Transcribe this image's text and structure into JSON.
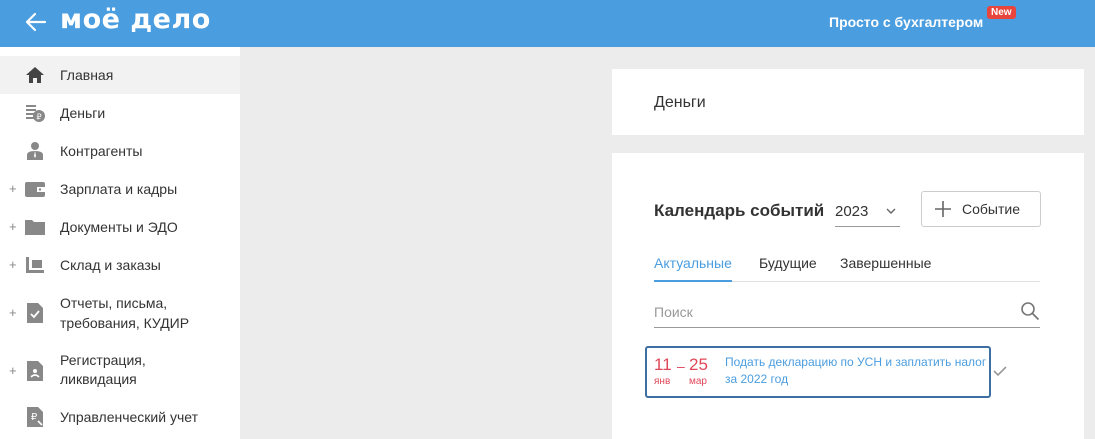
{
  "header": {
    "logo": "моё дело",
    "accountant_link": "Просто с бухгалтером",
    "new_badge": "New"
  },
  "sidebar": {
    "items": [
      {
        "label": "Главная",
        "icon": "home-icon",
        "active": true
      },
      {
        "label": "Деньги",
        "icon": "money-icon"
      },
      {
        "label": "Контрагенты",
        "icon": "contractor-icon"
      },
      {
        "label": "Зарплата и кадры",
        "icon": "wallet-icon",
        "expandable": true
      },
      {
        "label": "Документы и ЭДО",
        "icon": "folder-icon",
        "expandable": true
      },
      {
        "label": "Склад и заказы",
        "icon": "warehouse-icon",
        "expandable": true
      },
      {
        "label_line1": "Отчеты, письма,",
        "label_line2": "требования, КУДИР",
        "icon": "report-icon",
        "expandable": true
      },
      {
        "label_line1": "Регистрация,",
        "label_line2": "ликвидация",
        "icon": "registration-icon",
        "expandable": true
      },
      {
        "label": "Управленческий учет",
        "icon": "management-icon"
      }
    ]
  },
  "money_card": {
    "title": "Деньги"
  },
  "calendar": {
    "title": "Календарь событий",
    "year": "2023",
    "add_event_label": "Событие",
    "tabs": [
      "Актуальные",
      "Будущие",
      "Завершенные"
    ],
    "active_tab": "Актуальные",
    "search_placeholder": "Поиск",
    "events": [
      {
        "day_start": "11",
        "month_start": "янв",
        "dash": "–",
        "day_end": "25",
        "month_end": "мар",
        "text": "Подать декларацию по УСН и заплатить налог за 2022 год"
      }
    ]
  },
  "colors": {
    "header_bg": "#4a9ddf",
    "accent": "#4a9ddf",
    "date_red": "#e0485a",
    "badge_red": "#e8453c"
  }
}
